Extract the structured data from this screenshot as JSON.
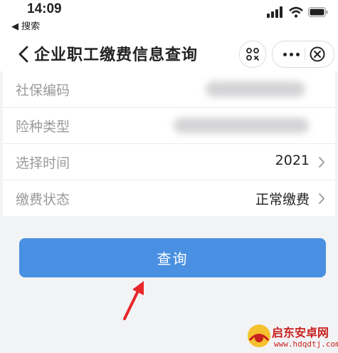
{
  "status_bar": {
    "time": "14:09",
    "back_app_label": "◀ 搜索"
  },
  "nav": {
    "title": "企业职工缴费信息查询"
  },
  "form": {
    "rows": [
      {
        "label": "社保编码",
        "value": ""
      },
      {
        "label": "险种类型",
        "value": ""
      },
      {
        "label": "选择时间",
        "value": "2021"
      },
      {
        "label": "缴费状态",
        "value": "正常缴费"
      }
    ]
  },
  "query_button": {
    "label": "查询"
  },
  "watermark": {
    "name": "启东安卓网",
    "url": "www.hdqdtj.com"
  },
  "colors": {
    "accent": "#4a90e2",
    "annotation": "#e8272b",
    "watermark": "#c9211e"
  }
}
